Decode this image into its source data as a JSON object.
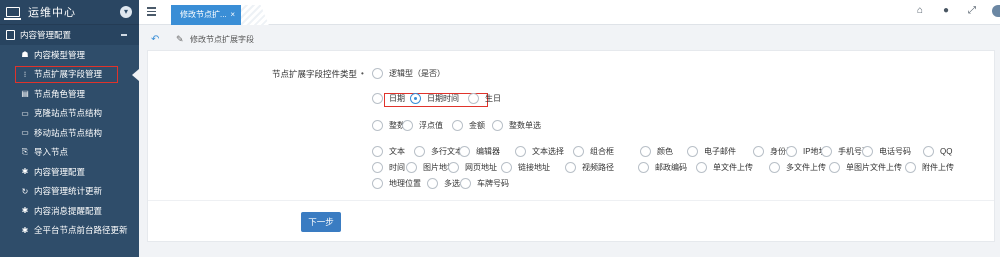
{
  "sidebar": {
    "title": "运维中心",
    "group": "内容管理配置",
    "items": [
      {
        "label": "内容模型管理",
        "icon": "cubes-icon",
        "glyph": "☗"
      },
      {
        "label": "节点扩展字段管理",
        "icon": "list-icon",
        "glyph": "⁝",
        "active": true
      },
      {
        "label": "节点角色管理",
        "icon": "table-icon",
        "glyph": "▤"
      },
      {
        "label": "克隆站点节点结构",
        "icon": "clone-icon",
        "glyph": "▭"
      },
      {
        "label": "移动站点节点结构",
        "icon": "move-icon",
        "glyph": "▭"
      },
      {
        "label": "导入节点",
        "icon": "import-icon",
        "glyph": "⎘"
      },
      {
        "label": "内容管理配置",
        "icon": "gear-icon",
        "glyph": "✱"
      },
      {
        "label": "内容管理统计更新",
        "icon": "refresh-icon",
        "glyph": "↻"
      },
      {
        "label": "内容消息提醒配置",
        "icon": "bell-icon",
        "glyph": "✱"
      },
      {
        "label": "全平台节点前台路径更新",
        "icon": "gear-icon",
        "glyph": "✱"
      }
    ]
  },
  "topbar": {
    "tab_label": "修改节点扩...",
    "tab_close": "×",
    "icons": [
      "home-icon",
      "chat-icon",
      "expand-icon",
      "user-icon"
    ]
  },
  "breadcrumb": {
    "text": "修改节点扩展字段"
  },
  "form": {
    "label": "节点扩展字段控件类型",
    "required_mark": "•",
    "selected": "日期时间",
    "button": "下一步",
    "rows": [
      {
        "y": 0,
        "options": [
          {
            "label": "逻辑型（是否）",
            "x": 0
          }
        ]
      },
      {
        "y": 1,
        "options": [
          {
            "label": "日期",
            "x": 0
          },
          {
            "label": "日期时间",
            "x": 1,
            "checked": true
          },
          {
            "label": "生日",
            "x": 2
          }
        ]
      },
      {
        "y": 2,
        "options": [
          {
            "label": "整数",
            "x": 0
          },
          {
            "label": "浮点值",
            "x": 1
          },
          {
            "label": "金额",
            "x": 2
          },
          {
            "label": "整数单选",
            "x": 3
          }
        ]
      },
      {
        "y": 3,
        "options": [
          {
            "label": "文本"
          },
          {
            "label": "多行文本"
          },
          {
            "label": "编辑器"
          },
          {
            "label": "文本选择"
          },
          {
            "label": "组合框"
          },
          {
            "label": "颜色"
          },
          {
            "label": "电子邮件"
          },
          {
            "label": "身份证"
          },
          {
            "label": "IP地址"
          },
          {
            "label": "手机号码"
          },
          {
            "label": "电话号码"
          },
          {
            "label": "QQ"
          }
        ]
      },
      {
        "y": 4,
        "options": [
          {
            "label": "时间"
          },
          {
            "label": "图片地址"
          },
          {
            "label": "网页地址"
          },
          {
            "label": "链接地址"
          },
          {
            "label": "视频路径"
          },
          {
            "label": "邮政编码"
          },
          {
            "label": "单文件上传"
          },
          {
            "label": "多文件上传"
          },
          {
            "label": "单图片文件上传"
          },
          {
            "label": "附件上传"
          }
        ]
      },
      {
        "y": 5,
        "options": [
          {
            "label": "地理位置"
          },
          {
            "label": "多选"
          },
          {
            "label": "车牌号码"
          }
        ]
      }
    ]
  }
}
